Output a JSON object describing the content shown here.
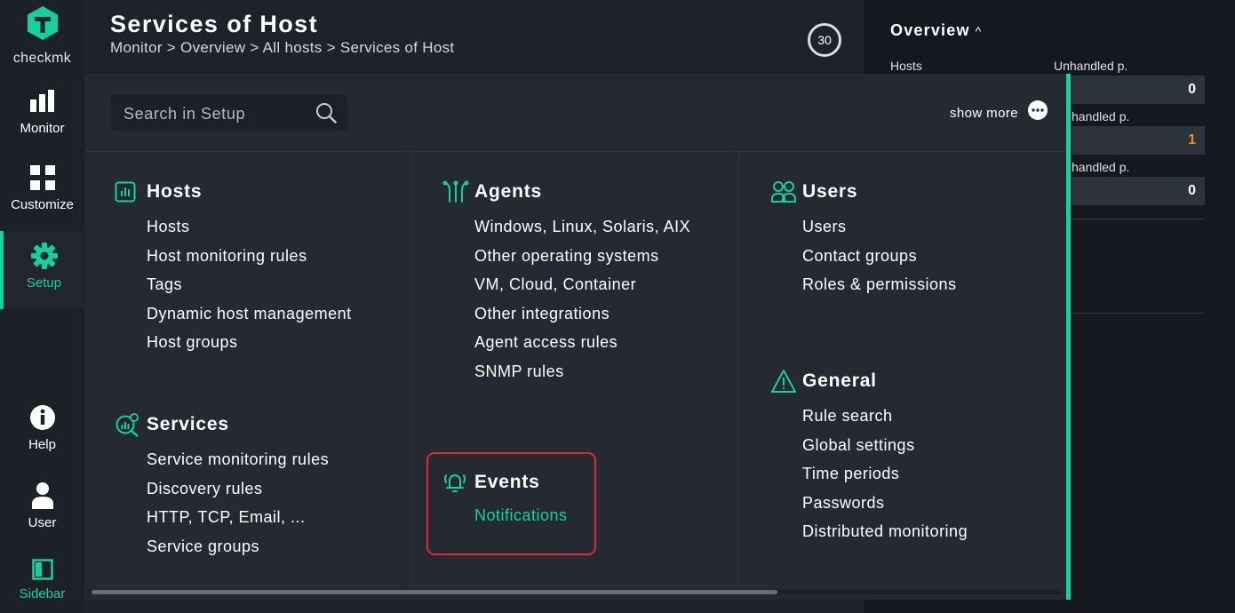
{
  "app": {
    "logo_text": "checkmk"
  },
  "nav": {
    "monitor": "Monitor",
    "customize": "Customize",
    "setup": "Setup",
    "help": "Help",
    "user": "User",
    "sidebar": "Sidebar"
  },
  "header": {
    "title": "Services of Host",
    "breadcrumb": "Monitor > Overview > All hosts > Services of Host",
    "reload_seconds": "30"
  },
  "overview": {
    "title": "Overview",
    "toggle": "^",
    "col1_label": "Hosts",
    "col2_label": "Unhandled p.",
    "row2_label": "handled p.",
    "row3_label": "handled p.",
    "values": [
      "0",
      "1",
      "0"
    ]
  },
  "menu": {
    "search_placeholder": "Search in Setup",
    "show_more": "show more",
    "topics": {
      "hosts": {
        "title": "Hosts",
        "items": [
          "Hosts",
          "Host monitoring rules",
          "Tags",
          "Dynamic host management",
          "Host groups"
        ]
      },
      "services": {
        "title": "Services",
        "items": [
          "Service monitoring rules",
          "Discovery rules",
          "HTTP, TCP, Email, ...",
          "Service groups"
        ]
      },
      "agents": {
        "title": "Agents",
        "items": [
          "Windows, Linux, Solaris, AIX",
          "Other operating systems",
          "VM, Cloud, Container",
          "Other integrations",
          "Agent access rules",
          "SNMP rules"
        ]
      },
      "events": {
        "title": "Events",
        "items": [
          "Notifications"
        ]
      },
      "users": {
        "title": "Users",
        "items": [
          "Users",
          "Contact groups",
          "Roles & permissions"
        ]
      },
      "general": {
        "title": "General",
        "items": [
          "Rule search",
          "Global settings",
          "Time periods",
          "Passwords",
          "Distributed monitoring"
        ]
      }
    }
  },
  "colors": {
    "accent": "#15d1a0",
    "highlight_border": "#e02a2a",
    "warn_value": "#e88a2e"
  }
}
